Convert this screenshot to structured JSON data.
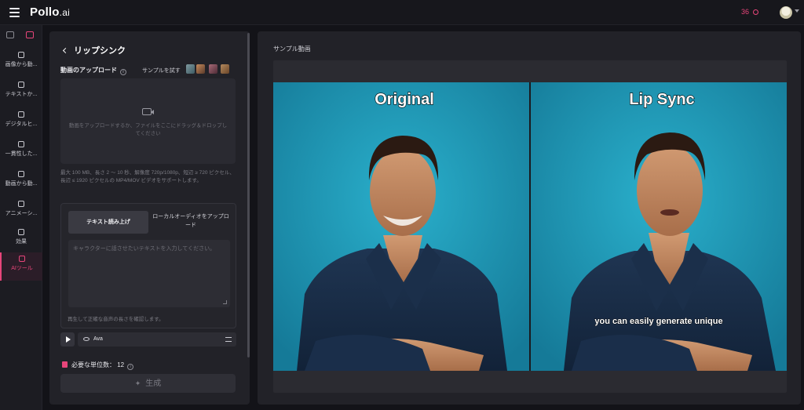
{
  "app": {
    "logo_main": "Pollo",
    "logo_suffix": ".ai",
    "credits": "36"
  },
  "rail": {
    "items": [
      {
        "label": "画像から動...",
        "icon": "image-to-video-icon"
      },
      {
        "label": "テキストか...",
        "icon": "text-to-video-icon"
      },
      {
        "label": "デジタルヒ...",
        "icon": "digital-human-icon"
      },
      {
        "label": "一貫性した...",
        "icon": "consistent-character-icon"
      },
      {
        "label": "動画から動...",
        "icon": "video-to-video-icon"
      },
      {
        "label": "アニメーシ...",
        "icon": "animation-icon"
      },
      {
        "label": "効果",
        "icon": "effects-icon"
      },
      {
        "label": "AIツール",
        "icon": "ai-tools-icon"
      }
    ]
  },
  "panel": {
    "title": "リップシンク",
    "upload_label": "動画のアップロード",
    "sample_label": "サンプルを試す",
    "dropzone_text": "動画をアップロードするか、ファイルをここにドラッグ＆ドロップしてください",
    "specs": "最大 100 MB、長さ 2 ～ 10 秒、解像度 720p/1080p、短辺 ≥ 720 ピクセル、長辺 ≤ 1920 ピクセルの MP4/MOV ビデオをサポートします。",
    "tab_tts": "テキスト読み上げ",
    "tab_audio": "ローカルオーディオをアップロード",
    "tts_placeholder": "キャラクターに話させたいテキストを入力してください。",
    "tts_hint": "再生して正確な音声の長さを確認します。",
    "voice_name": "Ava",
    "units_label": "必要な単位数：",
    "units_value": "12",
    "generate_label": "生成"
  },
  "preview": {
    "title": "サンプル動画",
    "left_label": "Original",
    "right_label": "Lip Sync",
    "subtitle": "you can easily generate unique"
  },
  "colors": {
    "accent": "#e8457a",
    "teal_bg": "#1e8fb0"
  }
}
